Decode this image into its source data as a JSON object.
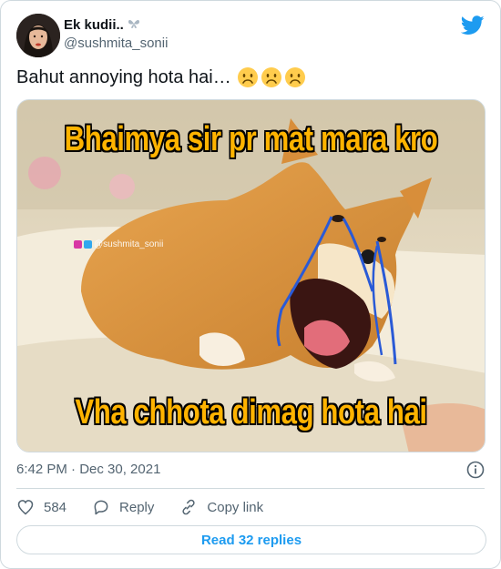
{
  "tweet": {
    "author_name": "Ek kudii..",
    "author_handle": "@sushmita_sonii",
    "text": "Bahut annoying hota hai…",
    "timestamp": "6:42 PM · Dec 30, 2021"
  },
  "media": {
    "meme_top": "Bhaimya sir pr mat mara kro",
    "meme_bottom": "Vha chhota dimag hota hai",
    "watermark": "@sushmita_sonii"
  },
  "actions": {
    "like_count": "584",
    "reply_label": "Reply",
    "copy_link_label": "Copy link"
  },
  "read_replies_label": "Read 32 replies",
  "colors": {
    "twitter_blue": "#1d9bf0",
    "meme_text": "#ffb300",
    "secondary_text": "#536471",
    "border": "#cfd9de"
  },
  "icons": [
    "twitter-bird-icon",
    "frowning-face-icon",
    "info-icon",
    "heart-icon",
    "reply-icon",
    "link-icon",
    "butterfly-emoji-icon"
  ]
}
